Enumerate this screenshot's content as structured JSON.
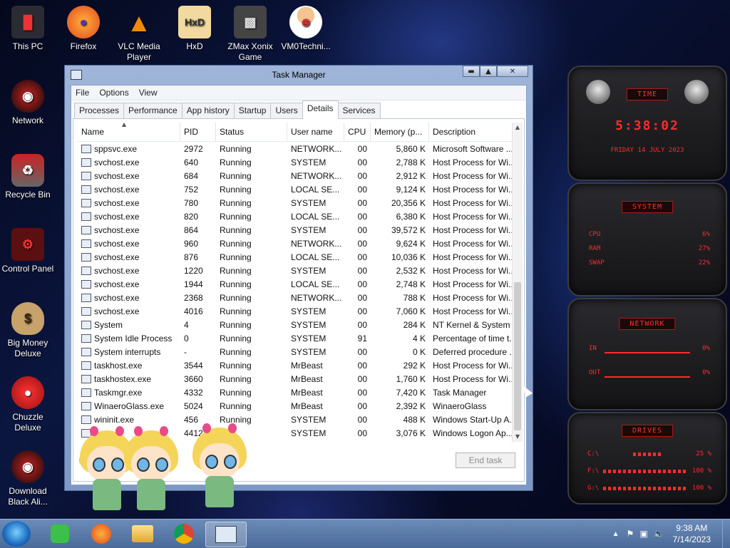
{
  "desktop": {
    "icons": [
      {
        "label": "This PC",
        "icon": "computer-icon"
      },
      {
        "label": "Firefox",
        "icon": "firefox-icon"
      },
      {
        "label": "VLC Media Player",
        "icon": "vlc-icon"
      },
      {
        "label": "HxD",
        "icon": "hxd-icon"
      },
      {
        "label": "ZMax Xonix Game",
        "icon": "game-icon"
      },
      {
        "label": "VM0Techni...",
        "icon": "person-icon"
      },
      {
        "label": "Network",
        "icon": "network-icon"
      },
      {
        "label": "Recycle Bin",
        "icon": "recycle-bin-icon"
      },
      {
        "label": "Control Panel",
        "icon": "control-panel-icon"
      },
      {
        "label": "Big Money Deluxe",
        "icon": "money-bag-icon"
      },
      {
        "label": "Chuzzle Deluxe",
        "icon": "chuzzle-icon"
      },
      {
        "label": "Download Black Ali...",
        "icon": "alien-icon"
      }
    ]
  },
  "task_manager": {
    "title": "Task Manager",
    "menu": [
      "File",
      "Options",
      "View"
    ],
    "tabs": [
      "Processes",
      "Performance",
      "App history",
      "Startup",
      "Users",
      "Details",
      "Services"
    ],
    "active_tab": "Details",
    "columns": [
      "Name",
      "PID",
      "Status",
      "User name",
      "CPU",
      "Memory (p...",
      "Description"
    ],
    "sorted_column": "Name",
    "rows": [
      [
        "sppsvc.exe",
        "2972",
        "Running",
        "NETWORK...",
        "00",
        "5,860 K",
        "Microsoft Software ..."
      ],
      [
        "svchost.exe",
        "640",
        "Running",
        "SYSTEM",
        "00",
        "2,788 K",
        "Host Process for Wi..."
      ],
      [
        "svchost.exe",
        "684",
        "Running",
        "NETWORK...",
        "00",
        "2,912 K",
        "Host Process for Wi..."
      ],
      [
        "svchost.exe",
        "752",
        "Running",
        "LOCAL SE...",
        "00",
        "9,124 K",
        "Host Process for Wi..."
      ],
      [
        "svchost.exe",
        "780",
        "Running",
        "SYSTEM",
        "00",
        "20,356 K",
        "Host Process for Wi..."
      ],
      [
        "svchost.exe",
        "820",
        "Running",
        "LOCAL SE...",
        "00",
        "6,380 K",
        "Host Process for Wi..."
      ],
      [
        "svchost.exe",
        "864",
        "Running",
        "SYSTEM",
        "00",
        "39,572 K",
        "Host Process for Wi..."
      ],
      [
        "svchost.exe",
        "960",
        "Running",
        "NETWORK...",
        "00",
        "9,624 K",
        "Host Process for Wi..."
      ],
      [
        "svchost.exe",
        "876",
        "Running",
        "LOCAL SE...",
        "00",
        "10,036 K",
        "Host Process for Wi..."
      ],
      [
        "svchost.exe",
        "1220",
        "Running",
        "SYSTEM",
        "00",
        "2,532 K",
        "Host Process for Wi..."
      ],
      [
        "svchost.exe",
        "1944",
        "Running",
        "LOCAL SE...",
        "00",
        "2,748 K",
        "Host Process for Wi..."
      ],
      [
        "svchost.exe",
        "2368",
        "Running",
        "NETWORK...",
        "00",
        "788 K",
        "Host Process for Wi..."
      ],
      [
        "svchost.exe",
        "4016",
        "Running",
        "SYSTEM",
        "00",
        "7,060 K",
        "Host Process for Wi..."
      ],
      [
        "System",
        "4",
        "Running",
        "SYSTEM",
        "00",
        "284 K",
        "NT Kernel & System"
      ],
      [
        "System Idle Process",
        "0",
        "Running",
        "SYSTEM",
        "91",
        "4 K",
        "Percentage of time t..."
      ],
      [
        "System interrupts",
        "-",
        "Running",
        "SYSTEM",
        "00",
        "0 K",
        "Deferred procedure ..."
      ],
      [
        "taskhost.exe",
        "3544",
        "Running",
        "MrBeast",
        "00",
        "292 K",
        "Host Process for Wi..."
      ],
      [
        "taskhostex.exe",
        "3660",
        "Running",
        "MrBeast",
        "00",
        "1,760 K",
        "Host Process for Wi..."
      ],
      [
        "Taskmgr.exe",
        "4332",
        "Running",
        "MrBeast",
        "00",
        "7,420 K",
        "Task Manager"
      ],
      [
        "WinaeroGlass.exe",
        "5024",
        "Running",
        "MrBeast",
        "00",
        "2,392 K",
        "WinaeroGlass"
      ],
      [
        "wininit.exe",
        "456",
        "Running",
        "SYSTEM",
        "00",
        "488 K",
        "Windows Start-Up A..."
      ],
      [
        "w",
        "4412",
        "ning",
        "SYSTEM",
        "00",
        "3,076 K",
        "Windows Logon Ap..."
      ]
    ],
    "end_task_label": "End task",
    "end_task_enabled": false
  },
  "widgets": {
    "time": {
      "title": "TIME",
      "time": "5:38:02",
      "date": "FRIDAY 14 JULY 2023"
    },
    "system": {
      "title": "SYSTEM",
      "cpu_label": "CPU",
      "cpu_value": "6%",
      "ram_label": "RAM",
      "ram_value": "27%",
      "swap_label": "SWAP",
      "swap_value": "22%"
    },
    "network": {
      "title": "NETWORK",
      "in_label": "IN",
      "in_value": "0%",
      "out_label": "OUT",
      "out_value": "0%"
    },
    "drives": {
      "title": "DRIVES",
      "items": [
        {
          "label": "C:\\",
          "value": "25 %"
        },
        {
          "label": "F:\\",
          "value": "100 %"
        },
        {
          "label": "G:\\",
          "value": "100 %"
        }
      ]
    }
  },
  "taskbar": {
    "items": [
      "start-orb",
      "notes-app",
      "firefox",
      "file-explorer",
      "chrome",
      "task-manager"
    ],
    "time": "9:38 AM",
    "date": "7/14/2023"
  },
  "colors": {
    "accent_red": "#ff2a2a",
    "taskbar": "#5a7aa8",
    "window_frame": "#8ea6cf"
  }
}
